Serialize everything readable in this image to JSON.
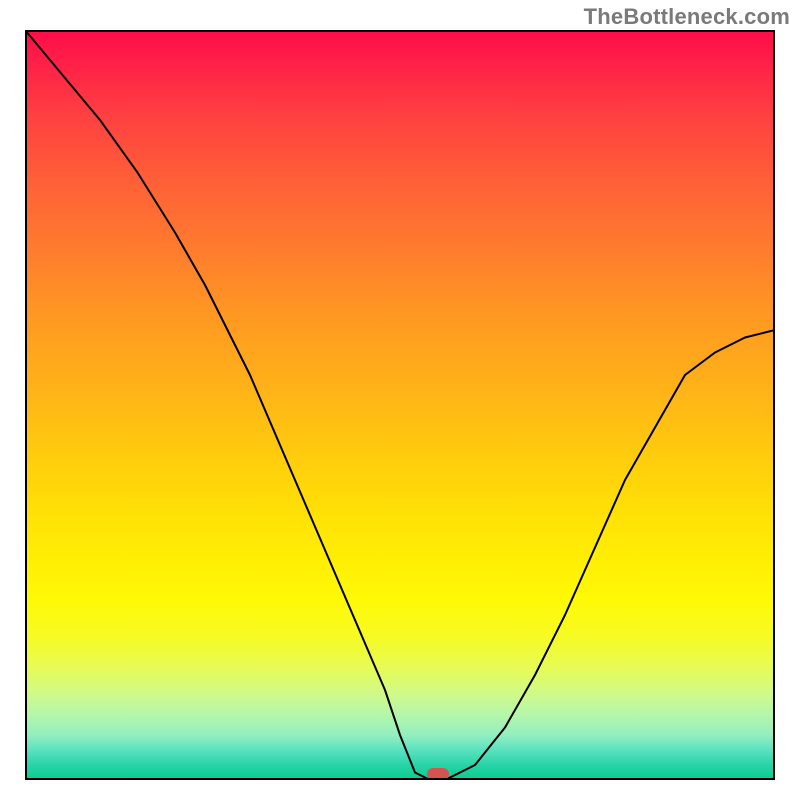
{
  "watermark": "TheBottleneck.com",
  "chart_data": {
    "type": "line",
    "title": "",
    "xlabel": "",
    "ylabel": "",
    "xlim": [
      0,
      100
    ],
    "ylim": [
      0,
      100
    ],
    "grid": false,
    "series": [
      {
        "name": "bottleneck-curve",
        "x": [
          0,
          5,
          10,
          15,
          20,
          24,
          27,
          30,
          33,
          36,
          39,
          42,
          45,
          48,
          50,
          52,
          54,
          56,
          60,
          64,
          68,
          72,
          76,
          80,
          84,
          88,
          92,
          96,
          100
        ],
        "y": [
          100,
          94,
          88,
          81,
          73,
          66,
          60,
          54,
          47,
          40,
          33,
          26,
          19,
          12,
          6,
          1,
          0,
          0,
          2,
          7,
          14,
          22,
          31,
          40,
          47,
          54,
          57,
          59,
          60
        ]
      }
    ],
    "marker": {
      "x": 55,
      "y": 0.8,
      "color": "#d6544f"
    },
    "gradient_stops": [
      {
        "pos": 0,
        "color": "#ff0c49"
      },
      {
        "pos": 50,
        "color": "#ffc70f"
      },
      {
        "pos": 80,
        "color": "#fff906"
      },
      {
        "pos": 100,
        "color": "#06cd8e"
      }
    ]
  },
  "colors": {
    "curve": "#000000",
    "border": "#000000",
    "watermark": "#7a7a7a",
    "marker": "#d6544f"
  }
}
